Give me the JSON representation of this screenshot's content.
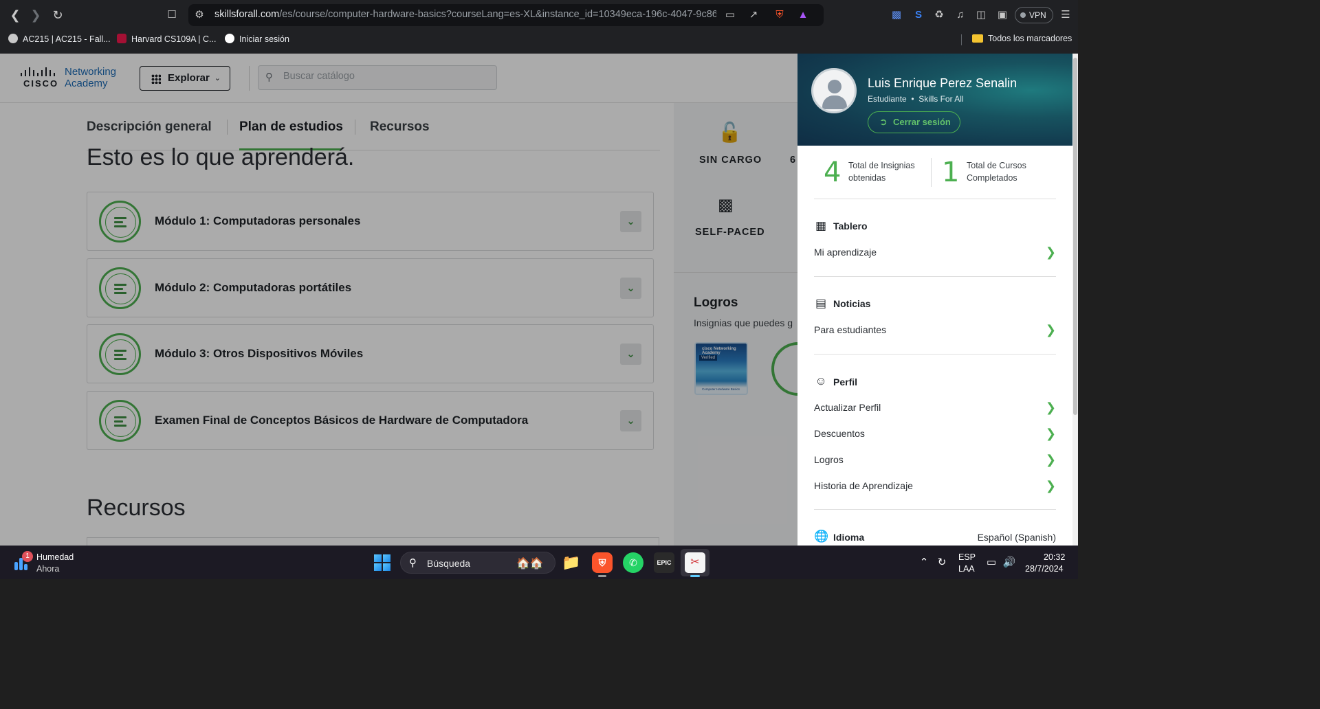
{
  "browser": {
    "url_host": "skillsforall.com",
    "url_path": "/es/course/computer-hardware-basics?courseLang=es-XL&instance_id=10349eca-196c-4047-9c86...",
    "vpn_label": "VPN",
    "bookmarks": [
      {
        "label": "AC215 | AC215 - Fall...",
        "color": "#e8eaed"
      },
      {
        "label": "Harvard CS109A | C...",
        "color": "#a41034"
      },
      {
        "label": "Iniciar sesión",
        "color": "#ffffff"
      }
    ],
    "bookmarks_folder": "Todos los marcadores"
  },
  "header": {
    "logo_brand": "CISCO",
    "logo_line1": "Networking",
    "logo_line2": "Academy",
    "explore_label": "Explorar",
    "search_placeholder": "Buscar catálogo"
  },
  "tabs": [
    {
      "label": "Descripción general",
      "active": false
    },
    {
      "label": "Plan de estudios",
      "active": true
    },
    {
      "label": "Recursos",
      "active": false
    }
  ],
  "curriculum": {
    "heading": "Esto es lo que aprenderá.",
    "modules": [
      {
        "title": "Módulo 1: Computadoras personales"
      },
      {
        "title": "Módulo 2: Computadoras portátiles"
      },
      {
        "title": "Módulo 3: Otros Dispositivos Móviles"
      },
      {
        "title": "Examen Final de Conceptos Básicos de Hardware de Computadora"
      }
    ],
    "resources_heading": "Recursos"
  },
  "course_side": {
    "price_label": "SIN CARGO",
    "extra_label": "6",
    "pace_label": "SELF-PACED",
    "achievements_title": "Logros",
    "achievements_sub": "Insignias que puedes g",
    "badge_brand": "cisco Networking Academy",
    "badge_verified": "Verified",
    "badge_course": "Computer Hardware Basics"
  },
  "profile": {
    "name": "Luis Enrique Perez Senalin",
    "role": "Estudiante",
    "org": "Skills For All",
    "logout_label": "Cerrar sesión",
    "stats": [
      {
        "value": "4",
        "label": "Total de Insignias obtenidas"
      },
      {
        "value": "1",
        "label": "Total de Cursos Completados"
      }
    ],
    "sections": [
      {
        "title": "Tablero",
        "icon": "dashboard-icon",
        "links": [
          "Mi aprendizaje"
        ]
      },
      {
        "title": "Noticias",
        "icon": "news-icon",
        "links": [
          "Para estudiantes"
        ]
      },
      {
        "title": "Perfil",
        "icon": "person-icon",
        "links": [
          "Actualizar Perfil",
          "Descuentos",
          "Logros",
          "Historia de Aprendizaje"
        ]
      }
    ],
    "language_title": "Idioma",
    "language_value": "Español (Spanish)"
  },
  "taskbar": {
    "weather_badge": "1",
    "weather_title": "Humedad",
    "weather_sub": "Ahora",
    "search_label": "Búsqueda",
    "lang_line1": "ESP",
    "lang_line2": "LAA",
    "time": "20:32",
    "date": "28/7/2024"
  }
}
